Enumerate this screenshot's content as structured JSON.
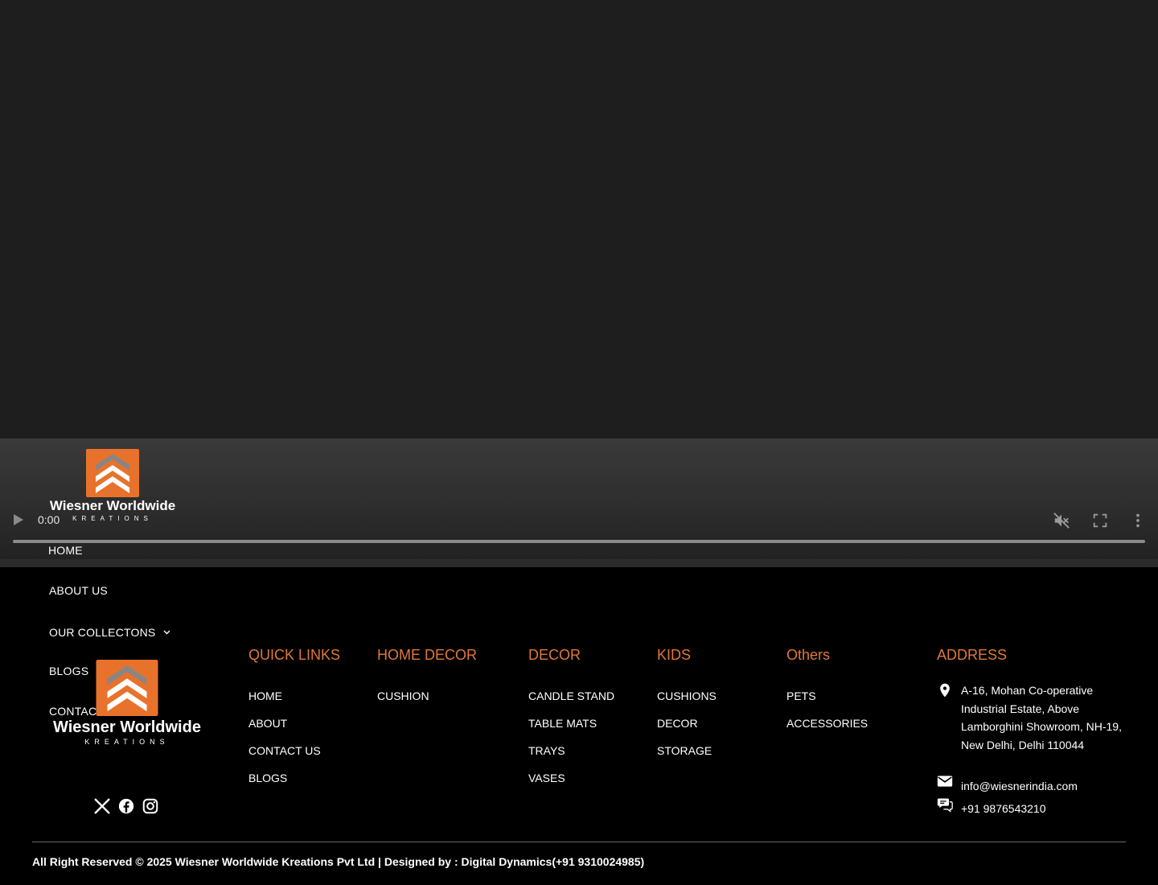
{
  "video": {
    "time": "0:00",
    "controls": [
      "play-icon",
      "mute-icon",
      "fullscreen-icon",
      "more-options-icon"
    ]
  },
  "brand": {
    "name": "Wiesner Worldwide",
    "sub": "KREATIONS",
    "logo_colors": {
      "orange": "#e8722c",
      "grey": "#8a8584"
    }
  },
  "nav": {
    "home": "HOME",
    "about": "ABOUT US",
    "collections": "OUR COLLECTONS",
    "blogs": "BLOGS",
    "contact": "CONTACT US"
  },
  "footer": {
    "accent_color": "#e0783a",
    "quick_links": {
      "title": "QUICK LINKS",
      "items": [
        "HOME",
        "ABOUT",
        "CONTACT US",
        "BLOGS"
      ]
    },
    "home_decor": {
      "title": "HOME DECOR",
      "items": [
        "CUSHION"
      ]
    },
    "decor": {
      "title": "DECOR",
      "items": [
        "CANDLE STAND",
        "TABLE MATS",
        "TRAYS",
        "VASES"
      ]
    },
    "kids": {
      "title": "KIDS",
      "items": [
        "CUSHIONS",
        "DECOR",
        "STORAGE"
      ]
    },
    "others": {
      "title": "Others",
      "items": [
        "PETS",
        "ACCESSORIES"
      ]
    },
    "address": {
      "title": "ADDRESS",
      "location": "A-16, Mohan Co-operative Industrial Estate, Above Lamborghini Showroom, NH-19, New Delhi, Delhi 110044",
      "email": "info@wiesnerindia.com",
      "phone": "+91 9876543210"
    },
    "social": [
      "x-icon",
      "facebook-icon",
      "instagram-icon"
    ],
    "copyright": "All Right Reserved © 2025 Wiesner Worldwide Kreations Pvt Ltd | Designed by : Digital Dynamics(+91 9310024985)"
  }
}
